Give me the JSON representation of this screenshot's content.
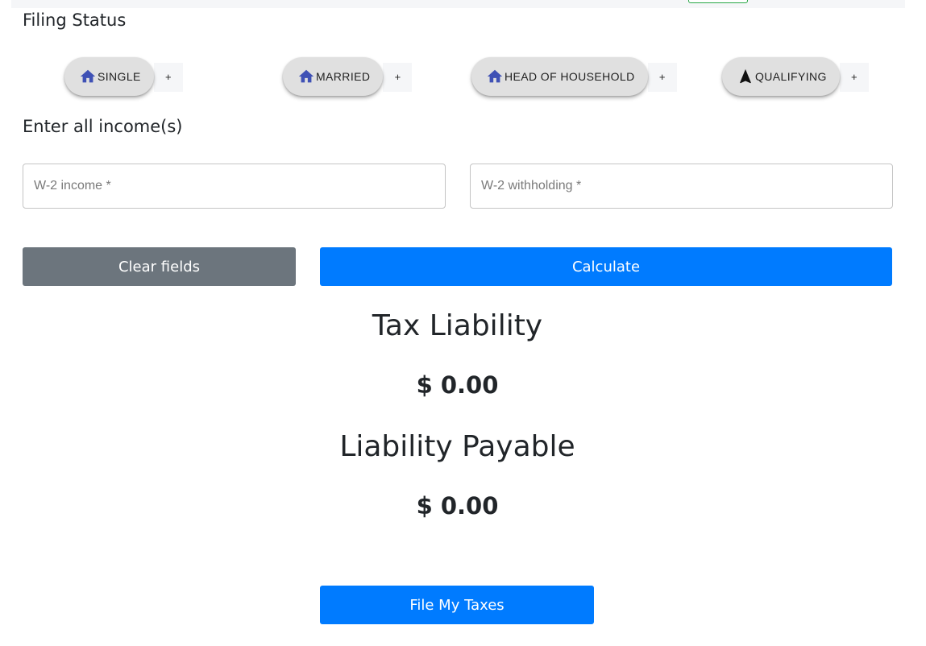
{
  "filing_status": {
    "title": "Filing Status",
    "options": [
      {
        "label": "SINGLE",
        "icon": "home-icon",
        "add": "+"
      },
      {
        "label": "MARRIED",
        "icon": "home-icon",
        "add": "+"
      },
      {
        "label": "HEAD OF HOUSEHOLD",
        "icon": "home-icon",
        "add": "+"
      },
      {
        "label": "QUALIFYING",
        "icon": "navigation-arrow-icon",
        "add": "+"
      }
    ]
  },
  "income": {
    "title": "Enter all income(s)",
    "w2_income": {
      "placeholder": "W-2 income *",
      "value": ""
    },
    "w2_withholding": {
      "placeholder": "W-2 withholding *",
      "value": ""
    }
  },
  "actions": {
    "clear_label": "Clear fields",
    "calculate_label": "Calculate",
    "file_label": "File My Taxes"
  },
  "results": {
    "tax_liability_label": "Tax Liability",
    "tax_liability_value": "$ 0.00",
    "liability_payable_label": "Liability Payable",
    "liability_payable_value": "$ 0.00"
  },
  "colors": {
    "primary": "#007bff",
    "secondary": "#6c757d",
    "icon_blue": "#3f51b5",
    "chip_bg": "#e0e0e0",
    "top_tab_border": "#28a745"
  }
}
